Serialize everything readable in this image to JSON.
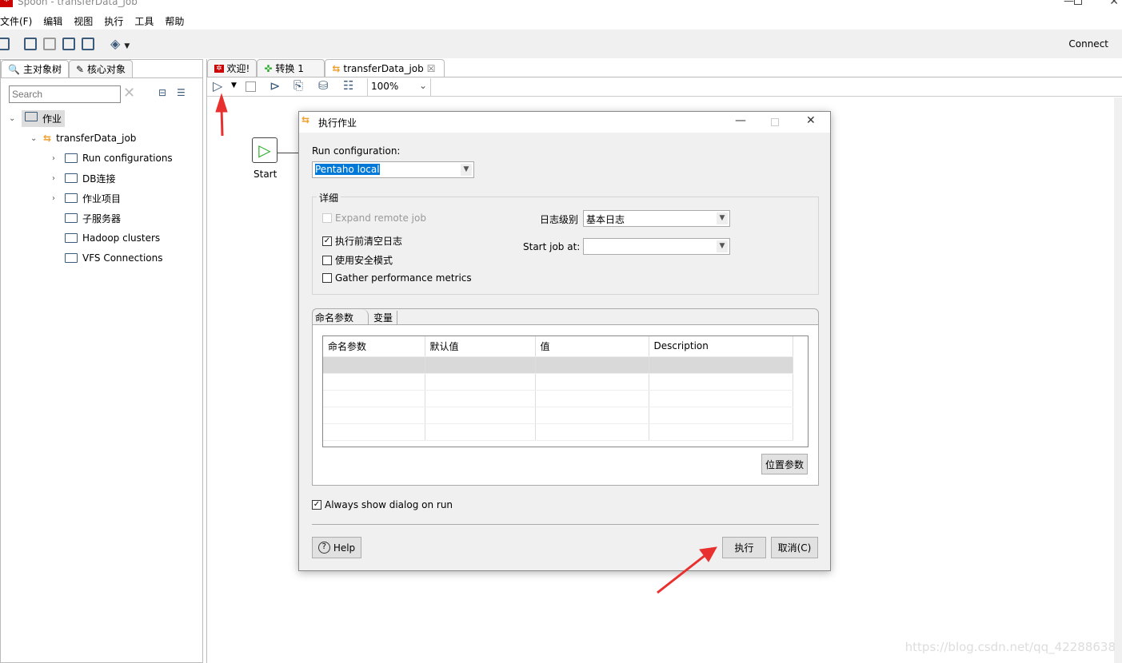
{
  "window": {
    "title": "Spoon - transferData_job",
    "logo": "Spoon"
  },
  "menu": [
    "文件(F)",
    "编辑",
    "视图",
    "执行",
    "工具",
    "帮助"
  ],
  "toolbar": {
    "connect": "Connect"
  },
  "left": {
    "tabs": [
      "主对象树",
      "核心对象"
    ],
    "search_placeholder": "Search",
    "tree": {
      "root": "作业",
      "job": "transferData_job",
      "children": [
        "Run configurations",
        "DB连接",
        "作业项目",
        "子服务器",
        "Hadoop clusters",
        "VFS Connections"
      ]
    }
  },
  "editor": {
    "tabs": [
      "欢迎!",
      "转换 1",
      "transferData_job"
    ],
    "zoom": "100%",
    "start_label": "Start"
  },
  "dialog": {
    "title": "执行作业",
    "run_config_label": "Run configuration:",
    "run_config_value": "Pentaho local",
    "details_label": "详细",
    "expand_remote": "Expand remote job",
    "clear_log": "执行前清空日志",
    "safe_mode": "使用安全模式",
    "gather_metrics": "Gather performance metrics",
    "log_level_label": "日志级别",
    "log_level_value": "基本日志",
    "start_job_label": "Start job at:",
    "start_job_value": "",
    "tabs": [
      "命名参数",
      "变量"
    ],
    "columns": [
      "命名参数",
      "默认值",
      "值",
      "Description"
    ],
    "position_params": "位置参数",
    "always_show": "Always show dialog on run",
    "help": "Help",
    "run": "执行",
    "cancel": "取消(C)",
    "checks": {
      "expand_remote": false,
      "clear_log": true,
      "safe_mode": false,
      "gather_metrics": false,
      "always_show": true
    }
  },
  "watermark": "https://blog.csdn.net/qq_42288638",
  "colors": {
    "annotation_arrow": "#e8312f",
    "selection": "#0078d7"
  }
}
